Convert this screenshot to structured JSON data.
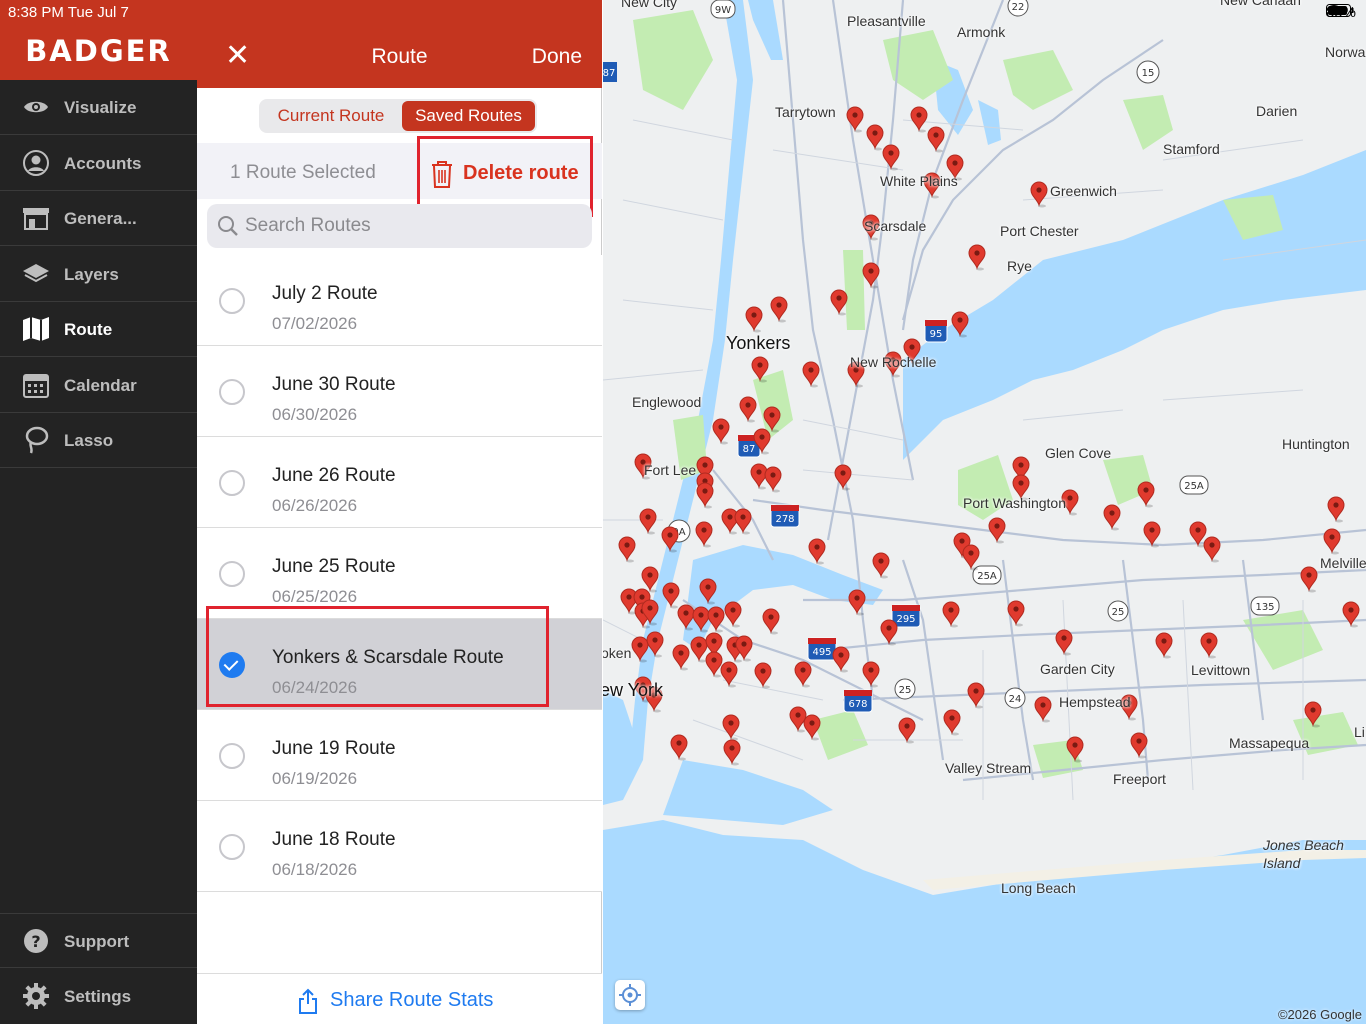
{
  "status": {
    "time": "8:38 PM   Tue Jul 7",
    "battery": "85%"
  },
  "brand": {
    "logo": "BADGER"
  },
  "sidebar": {
    "items": [
      {
        "label": "Visualize",
        "icon": "eye-icon"
      },
      {
        "label": "Accounts",
        "icon": "person-icon"
      },
      {
        "label": "Genera...",
        "icon": "storefront-icon"
      },
      {
        "label": "Layers",
        "icon": "layers-icon"
      },
      {
        "label": "Route",
        "icon": "map-icon",
        "active": true
      },
      {
        "label": "Calendar",
        "icon": "calendar-icon"
      },
      {
        "label": "Lasso",
        "icon": "lasso-icon"
      }
    ],
    "bottom": [
      {
        "label": "Support",
        "icon": "help-icon"
      },
      {
        "label": "Settings",
        "icon": "gear-icon"
      }
    ]
  },
  "panel": {
    "title": "Route",
    "close": "✕",
    "done": "Done",
    "tabs": {
      "current": "Current Route",
      "saved": "Saved Routes"
    },
    "selected_count": "1 Route Selected",
    "delete": "Delete route",
    "search_placeholder": "Search Routes",
    "routes": [
      {
        "name": "July 2 Route",
        "date": "07/02/2026",
        "selected": false
      },
      {
        "name": "June 30 Route",
        "date": "06/30/2026",
        "selected": false
      },
      {
        "name": "June 26 Route",
        "date": "06/26/2026",
        "selected": false
      },
      {
        "name": "June 25 Route",
        "date": "06/25/2026",
        "selected": false
      },
      {
        "name": "Yonkers & Scarsdale Route",
        "date": "06/24/2026",
        "selected": true
      },
      {
        "name": "June 19 Route",
        "date": "06/19/2026",
        "selected": false
      },
      {
        "name": "June 18 Route",
        "date": "06/18/2026",
        "selected": false
      }
    ],
    "share": "Share Route Stats"
  },
  "map": {
    "places": [
      "New City",
      "Pleasantville",
      "Armonk",
      "New Canaan",
      "Norwa",
      "Tarrytown",
      "Darien",
      "Stamford",
      "White Plains",
      "Greenwich",
      "Scarsdale",
      "Port Chester",
      "Rye",
      "Yonkers",
      "New Rochelle",
      "Englewood",
      "Glen Cove",
      "Huntington",
      "Fort Lee",
      "Port Washington",
      "Melville",
      "Garden City",
      "Levittown",
      "ew York",
      "Hempstead",
      "Massapequa",
      "Valley Stream",
      "Freeport",
      "Jones Beach Island",
      "Long Beach",
      "oken",
      "Li"
    ],
    "shields": [
      "9W",
      "22",
      "15",
      "87",
      "95",
      "9A",
      "278",
      "495",
      "295",
      "678",
      "25",
      "25A",
      "24",
      "135"
    ],
    "copyright": "©2026 Google",
    "colors": {
      "water": "#aadaff",
      "land": "#eef0f1",
      "park": "#c3ecb2",
      "pin": "#e03a2e"
    }
  }
}
